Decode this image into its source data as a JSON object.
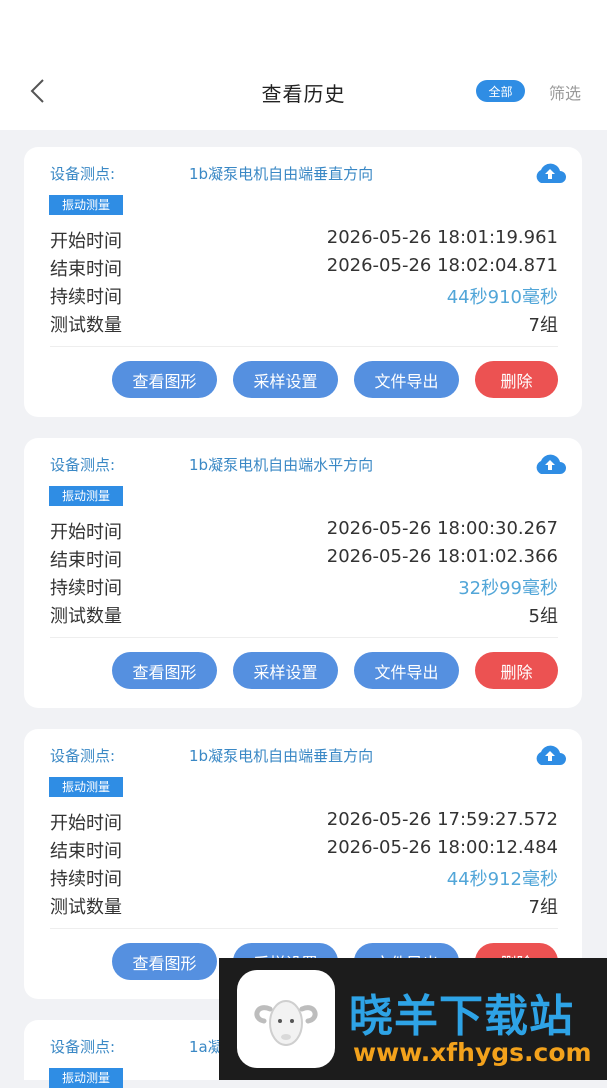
{
  "header": {
    "title": "查看历史",
    "badge": "全部",
    "filter": "筛选"
  },
  "labels": {
    "point": "设备测点:",
    "tag": "振动测量",
    "start": "开始时间",
    "end": "结束时间",
    "duration": "持续时间",
    "count": "测试数量"
  },
  "buttons": {
    "view": "查看图形",
    "sample": "采样设置",
    "export": "文件导出",
    "delete": "删除"
  },
  "records": [
    {
      "point": "1b凝泵电机自由端垂直方向",
      "start": "2026-05-26 18:01:19.961",
      "end": "2026-05-26 18:02:04.871",
      "duration": "44秒910毫秒",
      "count": "7组"
    },
    {
      "point": "1b凝泵电机自由端水平方向",
      "start": "2026-05-26 18:00:30.267",
      "end": "2026-05-26 18:01:02.366",
      "duration": "32秒99毫秒",
      "count": "5组"
    },
    {
      "point": "1b凝泵电机自由端垂直方向",
      "start": "2026-05-26 17:59:27.572",
      "end": "2026-05-26 18:00:12.484",
      "duration": "44秒912毫秒",
      "count": "7组"
    },
    {
      "point": "1a凝",
      "start": "",
      "end": "",
      "duration": "",
      "count": ""
    }
  ],
  "watermark": {
    "name": "晓羊下载站",
    "url": "www.xfhygs.com"
  },
  "colors": {
    "accent": "#2f8de4",
    "button": "#5590e0",
    "delete": "#ec5252",
    "label_blue": "#3a88c5"
  }
}
